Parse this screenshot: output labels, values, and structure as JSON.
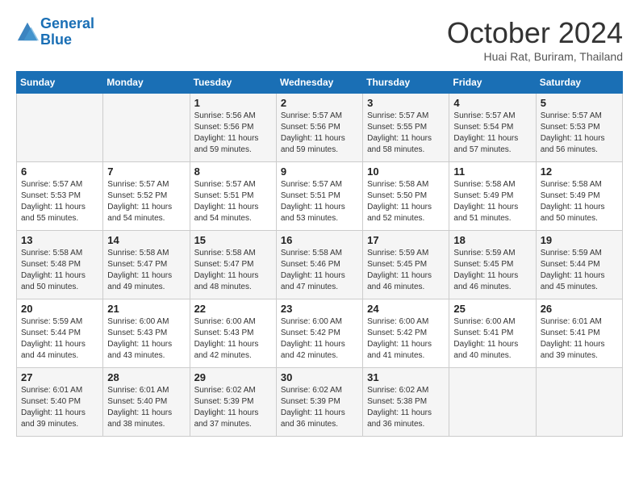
{
  "header": {
    "logo_line1": "General",
    "logo_line2": "Blue",
    "month_title": "October 2024",
    "location": "Huai Rat, Buriram, Thailand"
  },
  "calendar": {
    "weekdays": [
      "Sunday",
      "Monday",
      "Tuesday",
      "Wednesday",
      "Thursday",
      "Friday",
      "Saturday"
    ],
    "weeks": [
      [
        {
          "day": "",
          "info": ""
        },
        {
          "day": "",
          "info": ""
        },
        {
          "day": "1",
          "info": "Sunrise: 5:56 AM\nSunset: 5:56 PM\nDaylight: 11 hours and 59 minutes."
        },
        {
          "day": "2",
          "info": "Sunrise: 5:57 AM\nSunset: 5:56 PM\nDaylight: 11 hours and 59 minutes."
        },
        {
          "day": "3",
          "info": "Sunrise: 5:57 AM\nSunset: 5:55 PM\nDaylight: 11 hours and 58 minutes."
        },
        {
          "day": "4",
          "info": "Sunrise: 5:57 AM\nSunset: 5:54 PM\nDaylight: 11 hours and 57 minutes."
        },
        {
          "day": "5",
          "info": "Sunrise: 5:57 AM\nSunset: 5:53 PM\nDaylight: 11 hours and 56 minutes."
        }
      ],
      [
        {
          "day": "6",
          "info": "Sunrise: 5:57 AM\nSunset: 5:53 PM\nDaylight: 11 hours and 55 minutes."
        },
        {
          "day": "7",
          "info": "Sunrise: 5:57 AM\nSunset: 5:52 PM\nDaylight: 11 hours and 54 minutes."
        },
        {
          "day": "8",
          "info": "Sunrise: 5:57 AM\nSunset: 5:51 PM\nDaylight: 11 hours and 54 minutes."
        },
        {
          "day": "9",
          "info": "Sunrise: 5:57 AM\nSunset: 5:51 PM\nDaylight: 11 hours and 53 minutes."
        },
        {
          "day": "10",
          "info": "Sunrise: 5:58 AM\nSunset: 5:50 PM\nDaylight: 11 hours and 52 minutes."
        },
        {
          "day": "11",
          "info": "Sunrise: 5:58 AM\nSunset: 5:49 PM\nDaylight: 11 hours and 51 minutes."
        },
        {
          "day": "12",
          "info": "Sunrise: 5:58 AM\nSunset: 5:49 PM\nDaylight: 11 hours and 50 minutes."
        }
      ],
      [
        {
          "day": "13",
          "info": "Sunrise: 5:58 AM\nSunset: 5:48 PM\nDaylight: 11 hours and 50 minutes."
        },
        {
          "day": "14",
          "info": "Sunrise: 5:58 AM\nSunset: 5:47 PM\nDaylight: 11 hours and 49 minutes."
        },
        {
          "day": "15",
          "info": "Sunrise: 5:58 AM\nSunset: 5:47 PM\nDaylight: 11 hours and 48 minutes."
        },
        {
          "day": "16",
          "info": "Sunrise: 5:58 AM\nSunset: 5:46 PM\nDaylight: 11 hours and 47 minutes."
        },
        {
          "day": "17",
          "info": "Sunrise: 5:59 AM\nSunset: 5:45 PM\nDaylight: 11 hours and 46 minutes."
        },
        {
          "day": "18",
          "info": "Sunrise: 5:59 AM\nSunset: 5:45 PM\nDaylight: 11 hours and 46 minutes."
        },
        {
          "day": "19",
          "info": "Sunrise: 5:59 AM\nSunset: 5:44 PM\nDaylight: 11 hours and 45 minutes."
        }
      ],
      [
        {
          "day": "20",
          "info": "Sunrise: 5:59 AM\nSunset: 5:44 PM\nDaylight: 11 hours and 44 minutes."
        },
        {
          "day": "21",
          "info": "Sunrise: 6:00 AM\nSunset: 5:43 PM\nDaylight: 11 hours and 43 minutes."
        },
        {
          "day": "22",
          "info": "Sunrise: 6:00 AM\nSunset: 5:43 PM\nDaylight: 11 hours and 42 minutes."
        },
        {
          "day": "23",
          "info": "Sunrise: 6:00 AM\nSunset: 5:42 PM\nDaylight: 11 hours and 42 minutes."
        },
        {
          "day": "24",
          "info": "Sunrise: 6:00 AM\nSunset: 5:42 PM\nDaylight: 11 hours and 41 minutes."
        },
        {
          "day": "25",
          "info": "Sunrise: 6:00 AM\nSunset: 5:41 PM\nDaylight: 11 hours and 40 minutes."
        },
        {
          "day": "26",
          "info": "Sunrise: 6:01 AM\nSunset: 5:41 PM\nDaylight: 11 hours and 39 minutes."
        }
      ],
      [
        {
          "day": "27",
          "info": "Sunrise: 6:01 AM\nSunset: 5:40 PM\nDaylight: 11 hours and 39 minutes."
        },
        {
          "day": "28",
          "info": "Sunrise: 6:01 AM\nSunset: 5:40 PM\nDaylight: 11 hours and 38 minutes."
        },
        {
          "day": "29",
          "info": "Sunrise: 6:02 AM\nSunset: 5:39 PM\nDaylight: 11 hours and 37 minutes."
        },
        {
          "day": "30",
          "info": "Sunrise: 6:02 AM\nSunset: 5:39 PM\nDaylight: 11 hours and 36 minutes."
        },
        {
          "day": "31",
          "info": "Sunrise: 6:02 AM\nSunset: 5:38 PM\nDaylight: 11 hours and 36 minutes."
        },
        {
          "day": "",
          "info": ""
        },
        {
          "day": "",
          "info": ""
        }
      ]
    ]
  }
}
